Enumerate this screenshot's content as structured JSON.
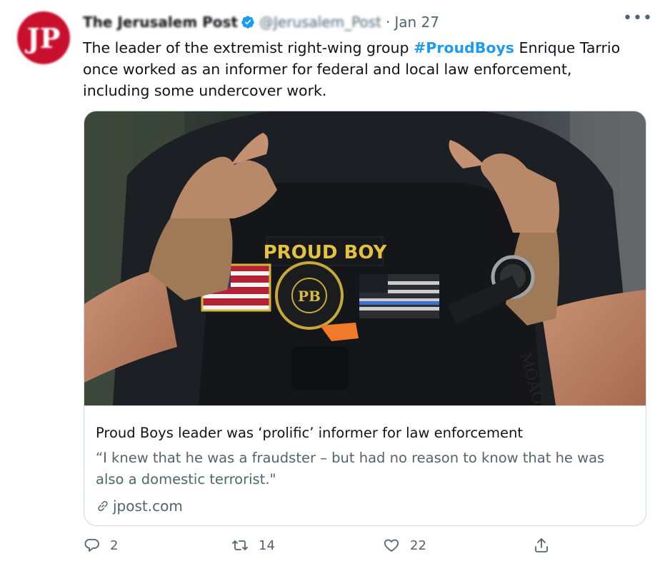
{
  "tweet": {
    "author_name": "The Jerusalem Post",
    "handle": "@Jerusalem_Post",
    "separator": "·",
    "date": "Jan 27",
    "more_label": "•••",
    "avatar_text": "JP",
    "text_before": "The leader of the extremist right-wing group ",
    "hashtag": "#ProudBoys",
    "text_after": " Enrique Tarrio once worked as an informer for federal and local law enforcement, including some undercover work."
  },
  "card": {
    "image_patch_text": "PROUD BOY",
    "image_emblem_text": "PB",
    "image_tattoo_text": "MOAOY",
    "title": "Proud Boys leader was ‘prolific’ informer for law enforcement",
    "description": "“I knew that he was a fraudster – but had no reason to know that he was also a domestic terrorist.\"",
    "domain": "jpost.com"
  },
  "actions": {
    "reply_count": "2",
    "retweet_count": "14",
    "like_count": "22"
  },
  "colors": {
    "accent": "#1d9bf0",
    "secondary_text": "#536471",
    "avatar_bg": "#c8102e",
    "border": "#cfd9de"
  },
  "icons": [
    "verified-badge-icon",
    "more-icon",
    "link-icon",
    "reply-icon",
    "retweet-icon",
    "like-icon",
    "share-icon"
  ]
}
